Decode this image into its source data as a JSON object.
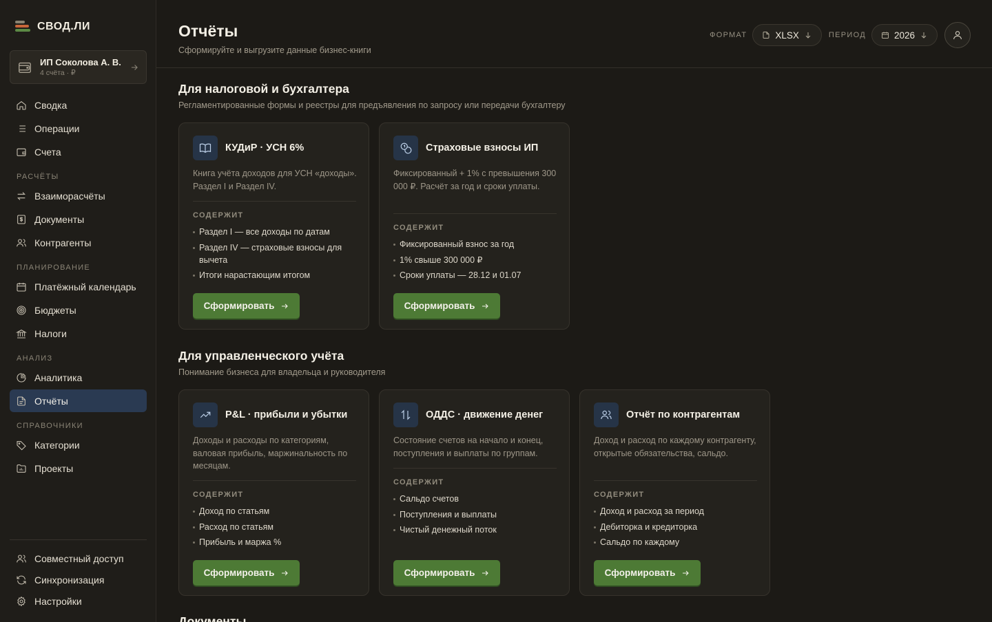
{
  "brand": {
    "name": "СВОД.ЛИ"
  },
  "account": {
    "name": "ИП Соколова А. В.",
    "sub": "4 счёта · ₽"
  },
  "nav": {
    "top": [
      {
        "label": "Сводка"
      },
      {
        "label": "Операции"
      },
      {
        "label": "Счета"
      }
    ],
    "groups": [
      {
        "title": "РАСЧЁТЫ",
        "items": [
          {
            "label": "Взаиморасчёты"
          },
          {
            "label": "Документы"
          },
          {
            "label": "Контрагенты"
          }
        ]
      },
      {
        "title": "ПЛАНИРОВАНИЕ",
        "items": [
          {
            "label": "Платёжный календарь"
          },
          {
            "label": "Бюджеты"
          },
          {
            "label": "Налоги"
          }
        ]
      },
      {
        "title": "АНАЛИЗ",
        "items": [
          {
            "label": "Аналитика"
          },
          {
            "label": "Отчёты"
          }
        ]
      },
      {
        "title": "СПРАВОЧНИКИ",
        "items": [
          {
            "label": "Категории"
          },
          {
            "label": "Проекты"
          }
        ]
      }
    ],
    "bottom": [
      {
        "label": "Совместный доступ"
      },
      {
        "label": "Синхронизация"
      },
      {
        "label": "Настройки"
      }
    ]
  },
  "header": {
    "title": "Отчёты",
    "subtitle": "Сформируйте и выгрузите данные бизнес-книги",
    "format_label": "ФОРМАТ",
    "format_value": "XLSX",
    "period_label": "ПЕРИОД",
    "period_value": "2026"
  },
  "sections": [
    {
      "title": "Для налоговой и бухгалтера",
      "subtitle": "Регламентированные формы и реестры для предъявления по запросу или передачи бухгалтеру",
      "cards": [
        {
          "title": "КУДиР · УСН 6%",
          "description": "Книга учёта доходов для УСН «доходы». Раздел I и Раздел IV.",
          "contains_label": "СОДЕРЖИТ",
          "items": [
            "Раздел I — все доходы по датам",
            "Раздел IV — страховые взносы для вычета",
            "Итоги нарастающим итогом"
          ],
          "button": "Сформировать"
        },
        {
          "title": "Страховые взносы ИП",
          "description": "Фиксированный + 1% с превышения 300 000 ₽. Расчёт за год и сроки уплаты.",
          "contains_label": "СОДЕРЖИТ",
          "items": [
            "Фиксированный взнос за год",
            "1% свыше 300 000 ₽",
            "Сроки уплаты — 28.12 и 01.07"
          ],
          "button": "Сформировать"
        }
      ]
    },
    {
      "title": "Для управленческого учёта",
      "subtitle": "Понимание бизнеса для владельца и руководителя",
      "cards": [
        {
          "title": "P&L · прибыли и убытки",
          "description": "Доходы и расходы по категориям, валовая прибыль, маржинальность по месяцам.",
          "contains_label": "СОДЕРЖИТ",
          "items": [
            "Доход по статьям",
            "Расход по статьям",
            "Прибыль и маржа %"
          ],
          "button": "Сформировать"
        },
        {
          "title": "ОДДС · движение денег",
          "description": "Состояние счетов на начало и конец, поступления и выплаты по группам.",
          "contains_label": "СОДЕРЖИТ",
          "items": [
            "Сальдо счетов",
            "Поступления и выплаты",
            "Чистый денежный поток"
          ],
          "button": "Сформировать"
        },
        {
          "title": "Отчёт по контрагентам",
          "description": "Доход и расход по каждому контрагенту, открытые обязательства, сальдо.",
          "contains_label": "СОДЕРЖИТ",
          "items": [
            "Доход и расход за период",
            "Дебиторка и кредиторка",
            "Сальдо по каждому"
          ],
          "button": "Сформировать"
        }
      ]
    }
  ],
  "next_section_title": "Документы",
  "colors": {
    "background": "#1c1a16",
    "accent_green": "#4d7a35",
    "active_nav": "#2a3a52",
    "icon_tile": "#263447"
  }
}
